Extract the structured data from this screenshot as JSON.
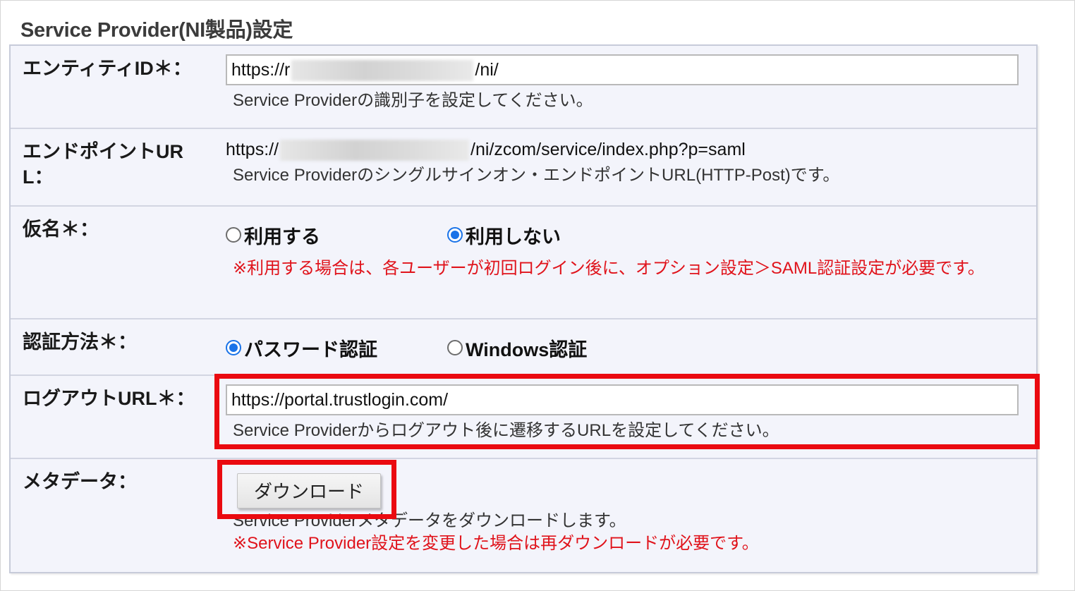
{
  "section": {
    "title": "Service Provider(NI製品)設定"
  },
  "entity_id": {
    "label": "エンティティID＊：",
    "value_prefix": "https://r",
    "value_suffix": "/ni/",
    "help": "Service Providerの識別子を設定してください。"
  },
  "endpoint_url": {
    "label": "エンドポイントURL：",
    "value_prefix": "https://",
    "value_suffix": "/ni/zcom/service/index.php?p=saml",
    "help": "Service Providerのシングルサインオン・エンドポイントURL(HTTP-Post)です。"
  },
  "pseudonym": {
    "label": "仮名＊：",
    "options": [
      {
        "label": "利用する",
        "checked": false
      },
      {
        "label": "利用しない",
        "checked": true
      }
    ],
    "warning": "※利用する場合は、各ユーザーが初回ログイン後に、オプション設定＞SAML認証設定が必要です。"
  },
  "auth_method": {
    "label": "認証方法＊：",
    "options": [
      {
        "label": "パスワード認証",
        "checked": true
      },
      {
        "label": "Windows認証",
        "checked": false
      }
    ]
  },
  "logout_url": {
    "label": "ログアウトURL＊：",
    "value": "https://portal.trustlogin.com/",
    "help": "Service Providerからログアウト後に遷移するURLを設定してください。"
  },
  "metadata": {
    "label": "メタデータ：",
    "button_label": "ダウンロード",
    "help": "Service Providerメタデータをダウンロードします。",
    "warning": "※Service Provider設定を変更した場合は再ダウンロードが必要です。"
  },
  "colors": {
    "highlight": "#ea0a10",
    "warning": "#e0131b",
    "radio_checked": "#1a73e8",
    "table_bg": "#f3f4fb"
  }
}
